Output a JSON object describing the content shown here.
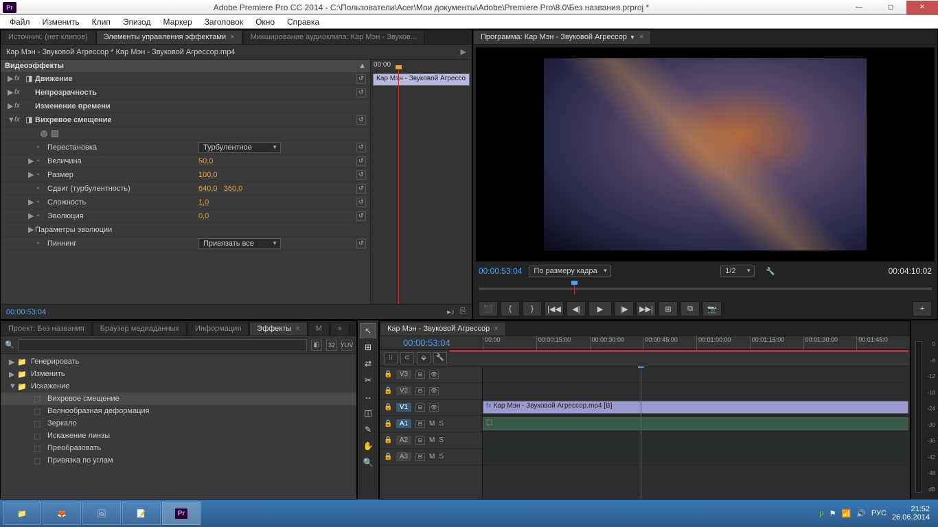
{
  "title": "Adobe Premiere Pro CC 2014 - C:\\Пользователи\\Acer\\Мои документы\\Adobe\\Premiere Pro\\8.0\\Без названия.prproj *",
  "app_icon": "Pr",
  "menu": [
    "Файл",
    "Изменить",
    "Клип",
    "Эпизод",
    "Маркер",
    "Заголовок",
    "Окно",
    "Справка"
  ],
  "ec": {
    "tabs": [
      "Источник: (нет клипов)",
      "Элементы управления эффектами",
      "Микширование аудиоклипа: Кар Мэн - Звуков..."
    ],
    "active_tab": 1,
    "header": "Кар Мэн - Звуковой Агрессор * Кар Мэн - Звуковой Агрессор.mp4",
    "section": "Видеоэффекты",
    "rows": [
      {
        "type": "fx",
        "tri": "▶",
        "lbl": "Движение",
        "reset": 1,
        "bold": 1
      },
      {
        "type": "fx",
        "tri": "▶",
        "lbl": "Непрозрачность",
        "reset": 1,
        "bold": 1,
        "nosw": 1
      },
      {
        "type": "fx",
        "tri": "▶",
        "lbl": "Изменение времени",
        "bold": 1,
        "nosw": 1,
        "nofx": 0
      },
      {
        "type": "fx",
        "tri": "▼",
        "lbl": "Вихревое смещение",
        "reset": 1,
        "bold": 1
      },
      {
        "type": "shapes"
      },
      {
        "type": "prop",
        "lbl": "Перестановка",
        "ctrl": "dropdown",
        "val": "Турбулентное",
        "reset": 1,
        "clock": 1
      },
      {
        "type": "prop",
        "tri": "▶",
        "lbl": "Величина",
        "val": "50,0",
        "reset": 1,
        "clock": 1
      },
      {
        "type": "prop",
        "tri": "▶",
        "lbl": "Размер",
        "val": "100,0",
        "reset": 1,
        "clock": 1
      },
      {
        "type": "prop",
        "lbl": "Сдвиг (турбулентность)",
        "val": "640,0",
        "val2": "360,0",
        "reset": 1,
        "clock": 1
      },
      {
        "type": "prop",
        "tri": "▶",
        "lbl": "Сложность",
        "val": "1,0",
        "reset": 1,
        "clock": 1
      },
      {
        "type": "prop",
        "tri": "▶",
        "lbl": "Эволюция",
        "val": "0,0",
        "reset": 1,
        "clock": 1
      },
      {
        "type": "prop",
        "tri": "▶",
        "lbl": "Параметры эволюции"
      },
      {
        "type": "prop",
        "lbl": "Пиннинг",
        "ctrl": "dropdown",
        "val": "Привязать все",
        "reset": 1,
        "clock": 1
      }
    ],
    "mini_tc": "00:00",
    "mini_clip": "Кар Мэн - Звуковой Агрессо",
    "foot_tc": "00:00:53:04"
  },
  "program": {
    "tab": "Программа: Кар Мэн - Звуковой Агрессор",
    "tc_left": "00:00:53:04",
    "fit": "По размеру кадра",
    "res": "1/2",
    "tc_right": "00:04:10:02",
    "buttons": [
      "⬛",
      "{",
      "}",
      "|◀◀",
      "◀|",
      "▶",
      "|▶",
      "▶▶|",
      "⊞",
      "⧉",
      "📷"
    ]
  },
  "project": {
    "tabs": [
      "Проект: Без названия",
      "Браузер медиаданных",
      "Информация",
      "Эффекты",
      "М",
      "»"
    ],
    "active_tab": 3,
    "search_ph": "",
    "icons": [
      "◧",
      "32",
      "YUV"
    ],
    "tree": [
      {
        "tri": "▶",
        "type": "folder",
        "lbl": "Генерировать"
      },
      {
        "tri": "▶",
        "type": "folder",
        "lbl": "Изменить"
      },
      {
        "tri": "▼",
        "type": "folder",
        "lbl": "Искажение"
      },
      {
        "type": "fx",
        "lbl": "Вихревое смещение",
        "sel": 1
      },
      {
        "type": "fx",
        "lbl": "Волнообразная деформация"
      },
      {
        "type": "fx",
        "lbl": "Зеркало"
      },
      {
        "type": "fx",
        "lbl": "Искажение линзы"
      },
      {
        "type": "fx",
        "lbl": "Преобразовать"
      },
      {
        "type": "fx",
        "lbl": "Привязка по углам"
      }
    ]
  },
  "tools": [
    "↖",
    "⊞",
    "⇄",
    "✂",
    "↔",
    "◫",
    "✎",
    "✋",
    "🔍"
  ],
  "timeline": {
    "tab": "Кар Мэн - Звуковой Агрессор",
    "tc": "00:00:53:04",
    "ruler": [
      "00:00",
      "00:00:15:00",
      "00:00:30:00",
      "00:00:45:00",
      "00:01:00:00",
      "00:01:15:00",
      "00:01:30:00",
      "00:01:45:0"
    ],
    "tracks_v": [
      "V3",
      "V2",
      "V1"
    ],
    "tracks_a": [
      "A1",
      "A2",
      "A3"
    ],
    "clip_v": "Кар Мэн - Звуковой Агрессор.mp4 [В]",
    "m": "M",
    "s": "S"
  },
  "meter": [
    "0",
    "-6",
    "-12",
    "-18",
    "-24",
    "-30",
    "-36",
    "-42",
    "-48",
    "dB"
  ],
  "taskbar": {
    "time": "21:52",
    "date": "26.06.2014",
    "lang": "РУС"
  }
}
